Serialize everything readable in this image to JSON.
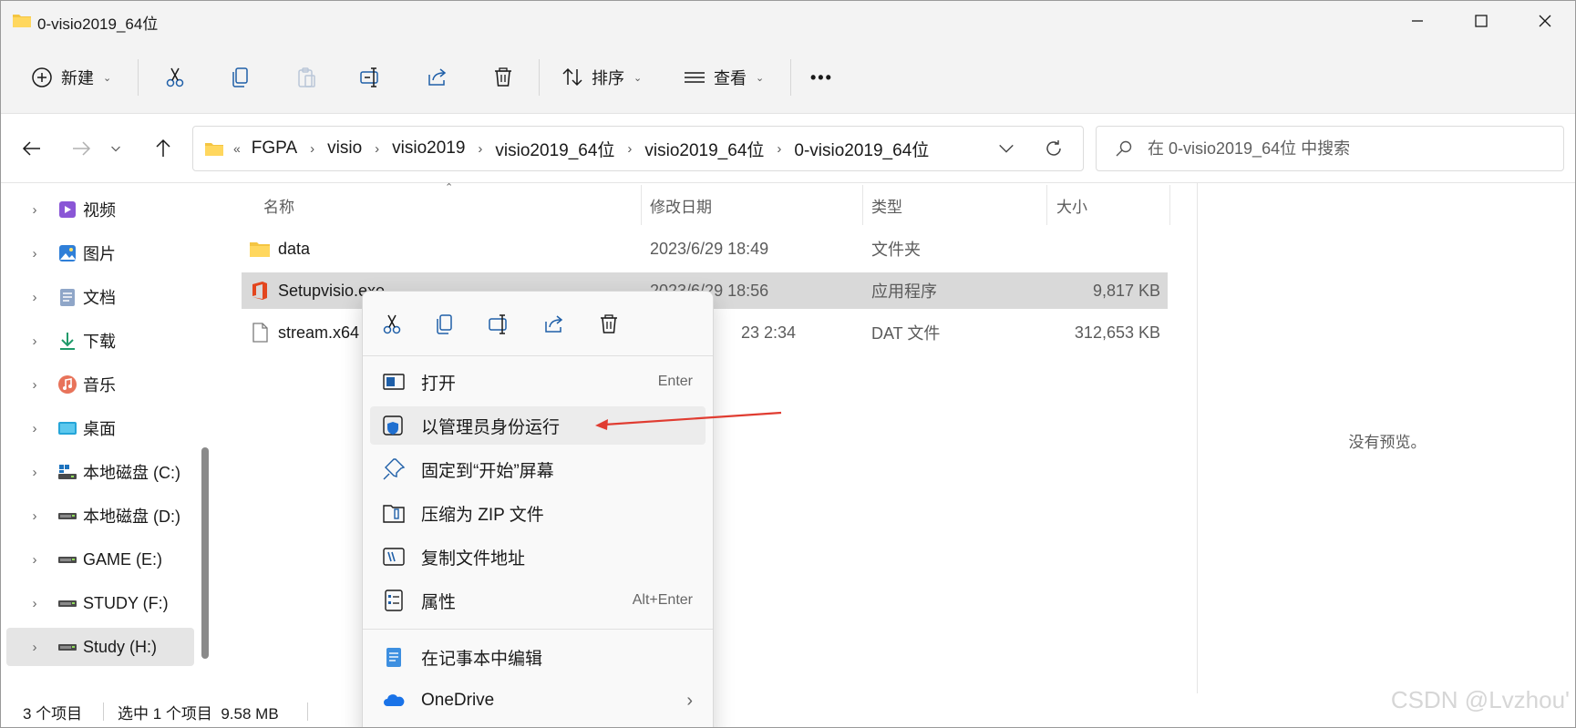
{
  "window": {
    "title": "0-visio2019_64位",
    "controls": [
      "minimize",
      "maximize",
      "close"
    ]
  },
  "toolbar": {
    "new_label": "新建",
    "sort_label": "排序",
    "view_label": "查看",
    "more_label": "•••"
  },
  "address": {
    "lead": "«",
    "crumbs": [
      "FGPA",
      "visio",
      "visio2019",
      "visio2019_64位",
      "visio2019_64位",
      "0-visio2019_64位"
    ]
  },
  "search": {
    "placeholder": "在 0-visio2019_64位 中搜索"
  },
  "sidebar": {
    "items": [
      {
        "label": "视频",
        "icon": "video-icon"
      },
      {
        "label": "图片",
        "icon": "pictures-icon"
      },
      {
        "label": "文档",
        "icon": "documents-icon"
      },
      {
        "label": "下载",
        "icon": "downloads-icon"
      },
      {
        "label": "音乐",
        "icon": "music-icon"
      },
      {
        "label": "桌面",
        "icon": "desktop-icon"
      },
      {
        "label": "本地磁盘 (C:)",
        "icon": "system-drive-icon"
      },
      {
        "label": "本地磁盘 (D:)",
        "icon": "drive-icon"
      },
      {
        "label": "GAME (E:)",
        "icon": "drive-icon"
      },
      {
        "label": "STUDY (F:)",
        "icon": "drive-icon"
      },
      {
        "label": "Study (H:)",
        "icon": "drive-icon",
        "selected": true
      }
    ]
  },
  "columns": {
    "name": "名称",
    "date": "修改日期",
    "type": "类型",
    "size": "大小"
  },
  "files": [
    {
      "name": "data",
      "date": "2023/6/29 18:49",
      "type": "文件夹",
      "size": "",
      "icon": "folder-icon"
    },
    {
      "name": "Setupvisio.exe",
      "date": "2023/6/29 18:56",
      "type": "应用程序",
      "size": "9,817 KB",
      "icon": "office-setup-icon",
      "selected": true
    },
    {
      "name": "stream.x64",
      "date": "23 2:34",
      "type": "DAT 文件",
      "size": "312,653 KB",
      "icon": "file-icon"
    }
  ],
  "preview": {
    "empty_text": "没有预览。"
  },
  "status": {
    "count": "3 个项目",
    "selection": "选中 1 个项目  9.58 MB"
  },
  "context_menu": {
    "tools": [
      "cut-icon",
      "copy-icon",
      "rename-icon",
      "share-icon",
      "delete-icon"
    ],
    "items": [
      {
        "label": "打开",
        "shortcut": "Enter",
        "icon": "open-icon"
      },
      {
        "label": "以管理员身份运行",
        "shortcut": "",
        "icon": "run-as-admin-icon",
        "highlighted": true
      },
      {
        "label": "固定到“开始”屏幕",
        "shortcut": "",
        "icon": "pin-icon"
      },
      {
        "label": "压缩为 ZIP 文件",
        "shortcut": "",
        "icon": "zip-icon"
      },
      {
        "label": "复制文件地址",
        "shortcut": "",
        "icon": "copy-path-icon"
      },
      {
        "label": "属性",
        "shortcut": "Alt+Enter",
        "icon": "properties-icon"
      },
      {
        "label": "在记事本中编辑",
        "shortcut": "",
        "icon": "notepad-icon"
      },
      {
        "label": "OneDrive",
        "shortcut": "",
        "icon": "onedrive-icon",
        "submenu": true
      }
    ]
  },
  "watermark": "CSDN @Lvzhou'",
  "colors": {
    "accent": "#0067c0",
    "annotation_arrow": "#e03c31",
    "selection": "#d9d9d9",
    "chrome": "#f3f3f3"
  }
}
